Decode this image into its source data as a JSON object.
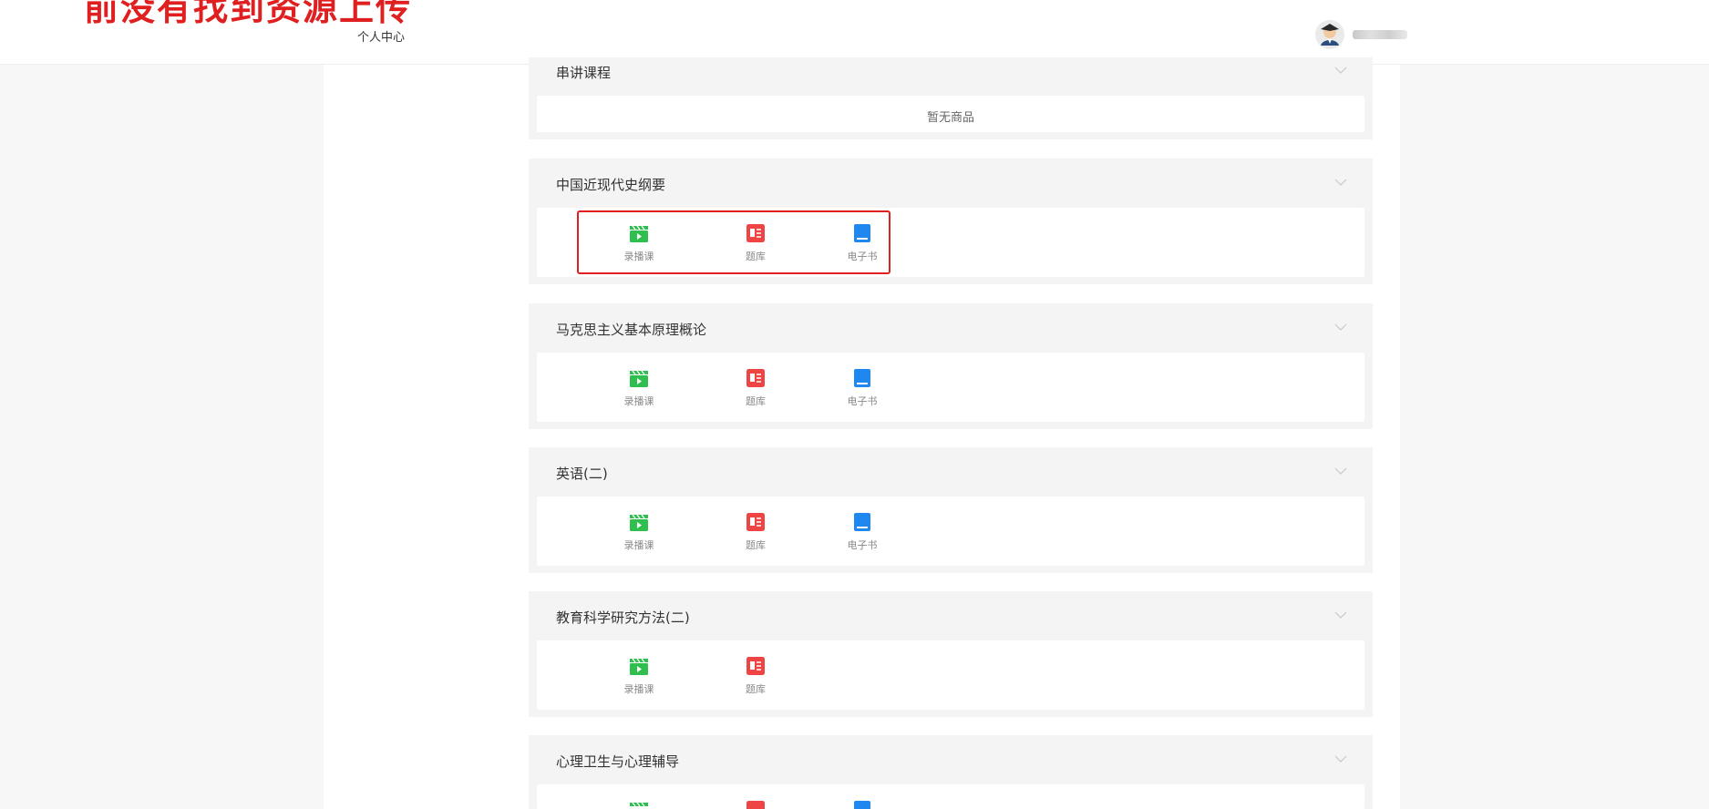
{
  "banner": {
    "text": "前没有找到资源上传"
  },
  "header": {
    "personal_center": "个人中心"
  },
  "courses": [
    {
      "title": "串讲课程",
      "empty_text": "暂无商品",
      "items": []
    },
    {
      "title": "中国近现代史纲要",
      "items": [
        {
          "label": "录播课",
          "icon": "video-clapper-icon"
        },
        {
          "label": "题库",
          "icon": "question-bank-icon"
        },
        {
          "label": "电子书",
          "icon": "ebook-icon"
        }
      ]
    },
    {
      "title": "马克思主义基本原理概论",
      "items": [
        {
          "label": "录播课",
          "icon": "video-clapper-icon"
        },
        {
          "label": "题库",
          "icon": "question-bank-icon"
        },
        {
          "label": "电子书",
          "icon": "ebook-icon"
        }
      ]
    },
    {
      "title": "英语(二)",
      "items": [
        {
          "label": "录播课",
          "icon": "video-clapper-icon"
        },
        {
          "label": "题库",
          "icon": "question-bank-icon"
        },
        {
          "label": "电子书",
          "icon": "ebook-icon"
        }
      ]
    },
    {
      "title": "教育科学研究方法(二)",
      "items": [
        {
          "label": "录播课",
          "icon": "video-clapper-icon"
        },
        {
          "label": "题库",
          "icon": "question-bank-icon"
        }
      ]
    },
    {
      "title": "心理卫生与心理辅导",
      "items": []
    }
  ],
  "colors": {
    "banner": "#e02020",
    "video_icon": "#2fbf4e",
    "question_icon": "#ef4444",
    "ebook_icon": "#1e88f0",
    "highlight_border": "#e02020"
  }
}
